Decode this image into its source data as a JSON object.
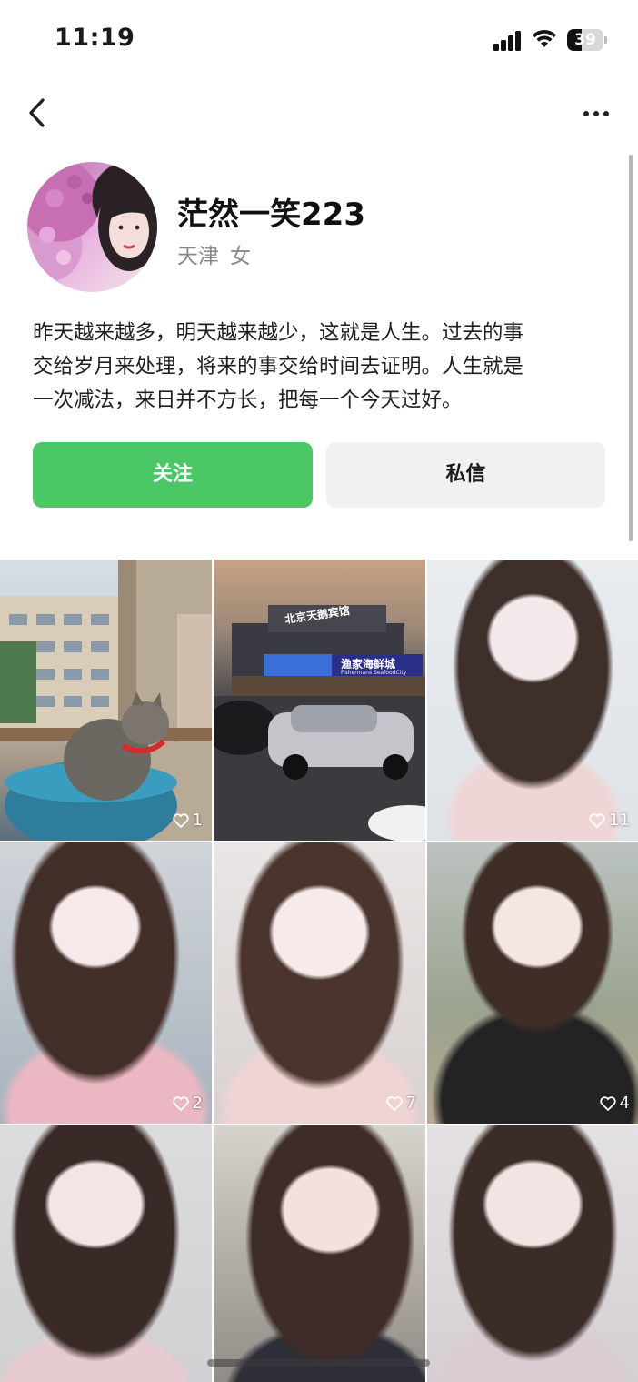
{
  "status": {
    "time": "11:19",
    "battery": "39",
    "battery_level": 0.39
  },
  "profile": {
    "name": "茫然一笑223",
    "location": "天津",
    "gender": "女",
    "bio_lines": [
      "昨天越来越多，明天越来越少，这就是人生。过去的事",
      "交给岁月来处理，将来的事交给时间去证明。人生就是",
      "一次减法，来日并不方长，把每一个今天过好。"
    ]
  },
  "actions": {
    "follow_label": "关注",
    "message_label": "私信"
  },
  "grid": {
    "items": [
      {
        "kind": "cat",
        "likes": "1"
      },
      {
        "kind": "street",
        "likes": "",
        "sign1": "北京天鹅宾馆",
        "sign2": "渔家海鲜城",
        "sign2_en": "Fishermans SeafoodCity"
      },
      {
        "kind": "portrait",
        "likes": "11"
      },
      {
        "kind": "portrait",
        "likes": "2"
      },
      {
        "kind": "portrait",
        "likes": "7"
      },
      {
        "kind": "portrait",
        "likes": "4"
      },
      {
        "kind": "portrait",
        "likes": ""
      },
      {
        "kind": "portrait",
        "likes": ""
      },
      {
        "kind": "portrait",
        "likes": ""
      }
    ]
  },
  "colors": {
    "follow_bg": "#4cc765",
    "message_bg": "#f1f1f1",
    "secondary_text": "#8a8a8a"
  }
}
